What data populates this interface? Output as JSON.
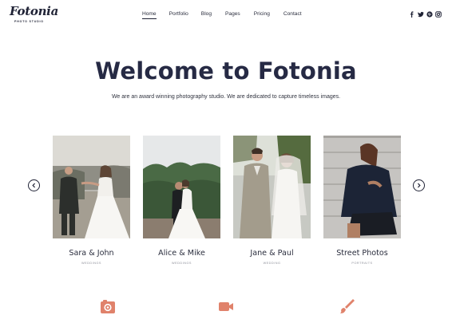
{
  "brand": {
    "name": "Fotonia",
    "tagline": "PHOTO STUDIO"
  },
  "nav": {
    "items": [
      {
        "label": "Home",
        "active": true
      },
      {
        "label": "Portfolio",
        "active": false
      },
      {
        "label": "Blog",
        "active": false
      },
      {
        "label": "Pages",
        "active": false
      },
      {
        "label": "Pricing",
        "active": false
      },
      {
        "label": "Contact",
        "active": false
      }
    ]
  },
  "social": [
    "facebook-icon",
    "twitter-icon",
    "pinterest-icon",
    "instagram-icon"
  ],
  "hero": {
    "title": "Welcome to Fotonia",
    "subtitle": "We are an award winning photography studio. We are dedicated to capture timeless images."
  },
  "gallery": {
    "items": [
      {
        "name": "Sara & John",
        "category": "WEDDINGS"
      },
      {
        "name": "Alice & Mike",
        "category": "WEDDINGS"
      },
      {
        "name": "Jane & Paul",
        "category": "WEDDING"
      },
      {
        "name": "Street Photos",
        "category": "PORTRAITS"
      }
    ]
  },
  "features": [
    "camera-icon",
    "video-camera-icon",
    "brush-icon"
  ],
  "colors": {
    "text": "#1f2235",
    "accent": "#e0826b",
    "muted": "#8d8f99"
  }
}
